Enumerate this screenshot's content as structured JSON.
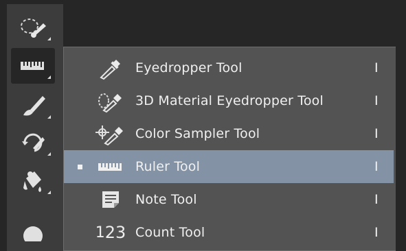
{
  "toolbar": {
    "tools": [
      {
        "name": "quick-selection-tool",
        "icon": "quick-selection-icon",
        "active": false
      },
      {
        "name": "ruler-tool",
        "icon": "ruler-icon",
        "active": true
      },
      {
        "name": "brush-tool",
        "icon": "brush-icon",
        "active": false
      },
      {
        "name": "history-brush-tool",
        "icon": "history-brush-icon",
        "active": false
      },
      {
        "name": "paint-bucket-tool",
        "icon": "paint-bucket-icon",
        "active": false
      },
      {
        "name": "dodge-tool",
        "icon": "dodge-icon",
        "active": false
      }
    ]
  },
  "flyout": {
    "items": [
      {
        "label": "Eyedropper Tool",
        "shortcut": "I",
        "icon": "eyedropper-icon",
        "selected": false
      },
      {
        "label": "3D Material Eyedropper Tool",
        "shortcut": "I",
        "icon": "3d-material-eyedropper-icon",
        "selected": false
      },
      {
        "label": "Color Sampler Tool",
        "shortcut": "I",
        "icon": "color-sampler-icon",
        "selected": false
      },
      {
        "label": "Ruler Tool",
        "shortcut": "I",
        "icon": "ruler-icon",
        "selected": true
      },
      {
        "label": "Note Tool",
        "shortcut": "I",
        "icon": "note-icon",
        "selected": false
      },
      {
        "label": "Count Tool",
        "shortcut": "I",
        "icon": "count-icon",
        "selected": false
      }
    ],
    "count_icon_glyph": {
      "a": "1",
      "b": "2",
      "c": "3"
    }
  },
  "colors": {
    "toolbar_bg": "#3c3c3c",
    "flyout_bg": "#535353",
    "selected_bg": "#8393a5",
    "text": "#f0f0f0"
  }
}
